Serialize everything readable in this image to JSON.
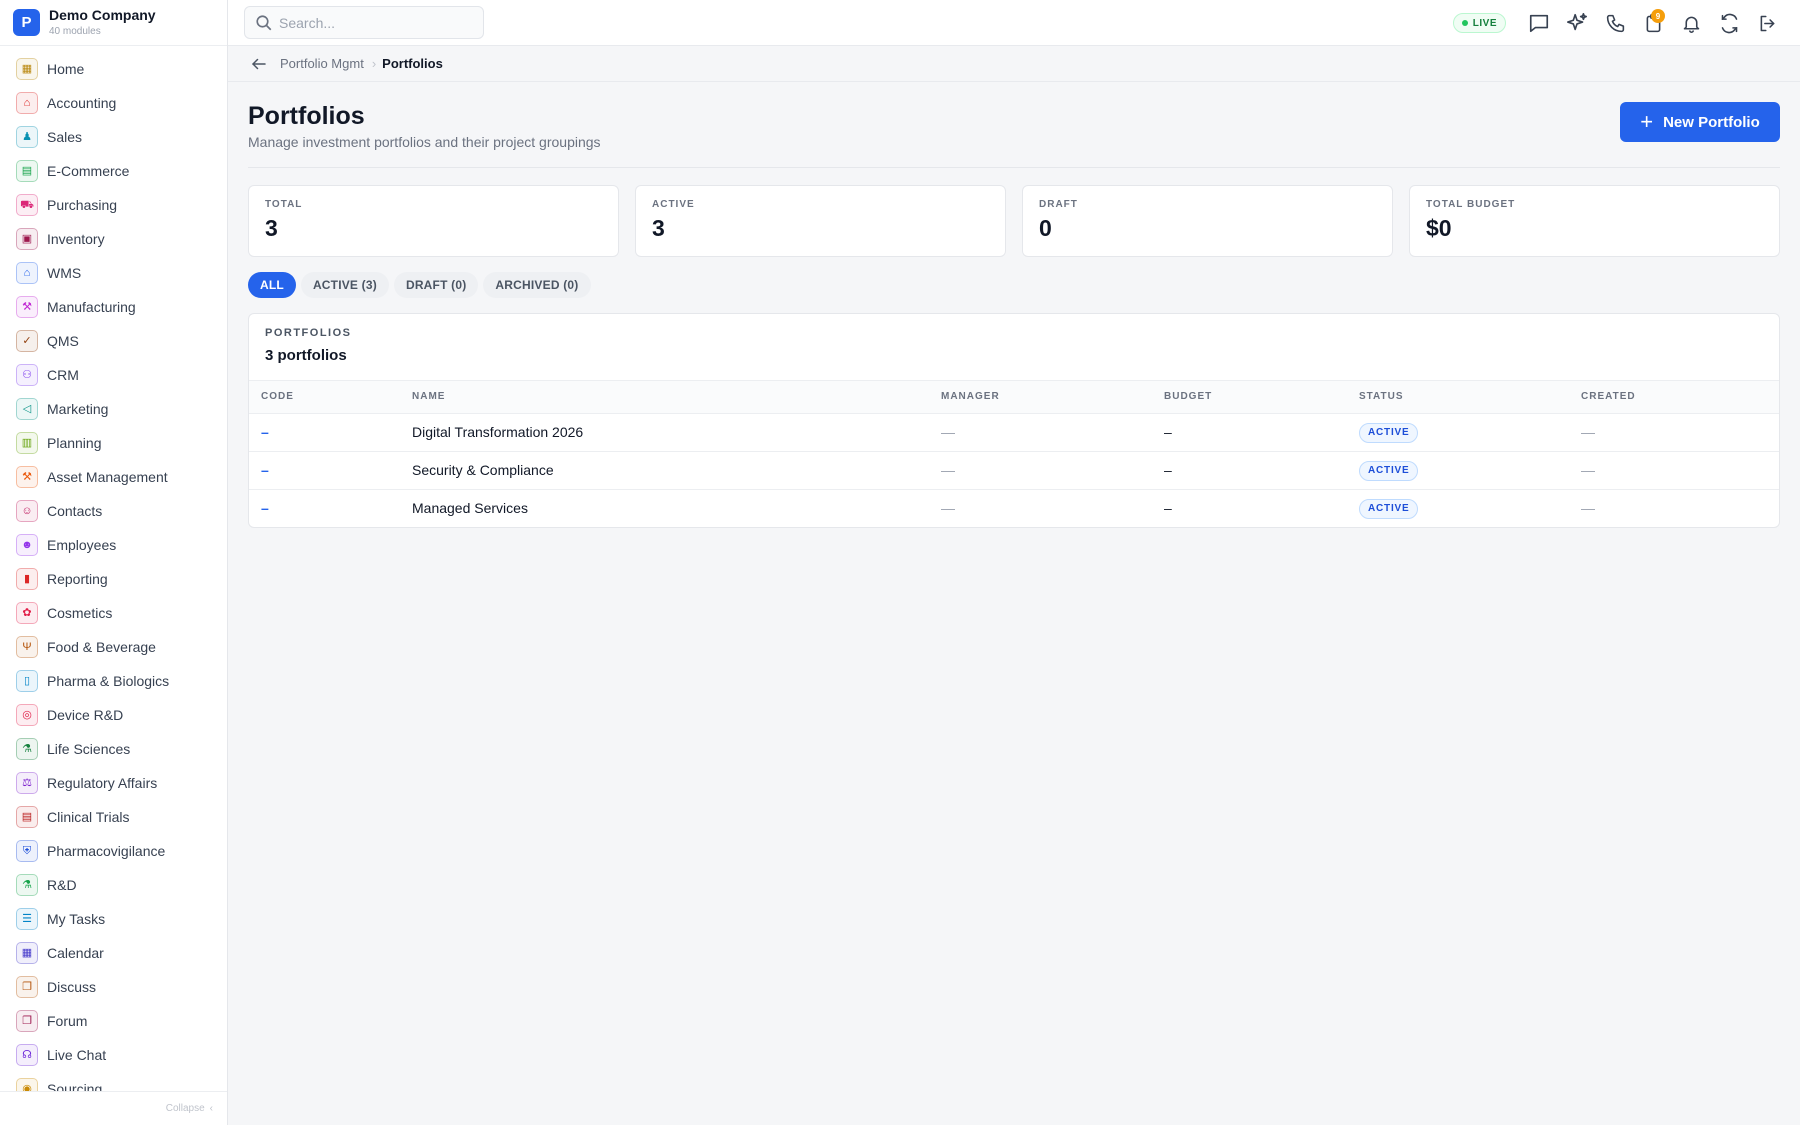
{
  "brand": {
    "logo_letter": "P",
    "name": "Demo Company",
    "subtitle": "40 modules"
  },
  "sidebar": {
    "items": [
      {
        "label": "Home",
        "icon": "grid-icon",
        "glyph": "▦",
        "color": "#b8860b"
      },
      {
        "label": "Accounting",
        "icon": "bank-icon",
        "glyph": "⌂",
        "color": "#dc2626"
      },
      {
        "label": "Sales",
        "icon": "tag-icon",
        "glyph": "♟",
        "color": "#0891b2"
      },
      {
        "label": "E-Commerce",
        "icon": "store-icon",
        "glyph": "▤",
        "color": "#16a34a"
      },
      {
        "label": "Purchasing",
        "icon": "cart-icon",
        "glyph": "⛟",
        "color": "#db2777"
      },
      {
        "label": "Inventory",
        "icon": "box-icon",
        "glyph": "▣",
        "color": "#9d174d"
      },
      {
        "label": "WMS",
        "icon": "warehouse-icon",
        "glyph": "⌂",
        "color": "#2563eb"
      },
      {
        "label": "Manufacturing",
        "icon": "factory-icon",
        "glyph": "⚒",
        "color": "#c026d3"
      },
      {
        "label": "QMS",
        "icon": "check-badge-icon",
        "glyph": "✓",
        "color": "#92400e"
      },
      {
        "label": "CRM",
        "icon": "users-icon",
        "glyph": "⚇",
        "color": "#7c3aed"
      },
      {
        "label": "Marketing",
        "icon": "megaphone-icon",
        "glyph": "◁",
        "color": "#0d9488"
      },
      {
        "label": "Planning",
        "icon": "clipboard-icon",
        "glyph": "▥",
        "color": "#65a30d"
      },
      {
        "label": "Asset Management",
        "icon": "tools-icon",
        "glyph": "⚒",
        "color": "#ea580c"
      },
      {
        "label": "Contacts",
        "icon": "contact-card-icon",
        "glyph": "☺",
        "color": "#be185d"
      },
      {
        "label": "Employees",
        "icon": "id-badge-icon",
        "glyph": "☻",
        "color": "#9333ea"
      },
      {
        "label": "Reporting",
        "icon": "bar-chart-icon",
        "glyph": "▮",
        "color": "#dc2626"
      },
      {
        "label": "Cosmetics",
        "icon": "flower-icon",
        "glyph": "✿",
        "color": "#e11d48"
      },
      {
        "label": "Food & Beverage",
        "icon": "utensils-icon",
        "glyph": "Ψ",
        "color": "#b45309"
      },
      {
        "label": "Pharma & Biologics",
        "icon": "pill-bottle-icon",
        "glyph": "▯",
        "color": "#0284c7"
      },
      {
        "label": "Device R&D",
        "icon": "device-icon",
        "glyph": "◎",
        "color": "#e11d48"
      },
      {
        "label": "Life Sciences",
        "icon": "microscope-icon",
        "glyph": "⚗",
        "color": "#15803d"
      },
      {
        "label": "Regulatory Affairs",
        "icon": "gavel-icon",
        "glyph": "⚖",
        "color": "#7e22ce"
      },
      {
        "label": "Clinical Trials",
        "icon": "clipboard-check-icon",
        "glyph": "▤",
        "color": "#b91c1c"
      },
      {
        "label": "Pharmacovigilance",
        "icon": "shield-icon",
        "glyph": "⛨",
        "color": "#1d4ed8"
      },
      {
        "label": "R&D",
        "icon": "flask-icon",
        "glyph": "⚗",
        "color": "#16a34a"
      },
      {
        "label": "My Tasks",
        "icon": "checklist-icon",
        "glyph": "☰",
        "color": "#0284c7"
      },
      {
        "label": "Calendar",
        "icon": "calendar-icon",
        "glyph": "▦",
        "color": "#4338ca"
      },
      {
        "label": "Discuss",
        "icon": "chat-bubbles-icon",
        "glyph": "❐",
        "color": "#b45309"
      },
      {
        "label": "Forum",
        "icon": "forum-icon",
        "glyph": "❐",
        "color": "#9d174d"
      },
      {
        "label": "Live Chat",
        "icon": "headset-icon",
        "glyph": "☊",
        "color": "#6d28d9"
      },
      {
        "label": "Sourcing",
        "icon": "sourcing-icon",
        "glyph": "◉",
        "color": "#ca8a04"
      }
    ],
    "collapse_label": "Collapse",
    "collapse_glyph": "‹"
  },
  "topbar": {
    "search_placeholder": "Search...",
    "live_label": "LIVE",
    "notification_count": "9",
    "icons": [
      "chat-icon",
      "sparkles-icon",
      "phone-icon",
      "clipboard-icon",
      "bell-icon",
      "refresh-icon",
      "logout-icon"
    ]
  },
  "breadcrumb": {
    "parent": "Portfolio Mgmt",
    "separator": "›",
    "current": "Portfolios"
  },
  "page": {
    "title": "Portfolios",
    "subtitle": "Manage investment portfolios and their project groupings",
    "new_button_label": "New Portfolio",
    "new_button_glyph": "+"
  },
  "stats": [
    {
      "label": "TOTAL",
      "value": "3"
    },
    {
      "label": "ACTIVE",
      "value": "3"
    },
    {
      "label": "DRAFT",
      "value": "0"
    },
    {
      "label": "TOTAL BUDGET",
      "value": "$0"
    }
  ],
  "tabs": [
    {
      "label": "ALL",
      "active": true
    },
    {
      "label": "ACTIVE (3)",
      "active": false
    },
    {
      "label": "DRAFT (0)",
      "active": false
    },
    {
      "label": "ARCHIVED (0)",
      "active": false
    }
  ],
  "table": {
    "section_label": "PORTFOLIOS",
    "count_label": "3 portfolios",
    "columns": [
      "CODE",
      "NAME",
      "MANAGER",
      "BUDGET",
      "STATUS",
      "CREATED"
    ],
    "rows": [
      {
        "code": "–",
        "name": "Digital Transformation 2026",
        "manager": "—",
        "budget": "–",
        "status": "ACTIVE",
        "created": "—"
      },
      {
        "code": "–",
        "name": "Security & Compliance",
        "manager": "—",
        "budget": "–",
        "status": "ACTIVE",
        "created": "—"
      },
      {
        "code": "–",
        "name": "Managed Services",
        "manager": "—",
        "budget": "–",
        "status": "ACTIVE",
        "created": "—"
      }
    ]
  }
}
